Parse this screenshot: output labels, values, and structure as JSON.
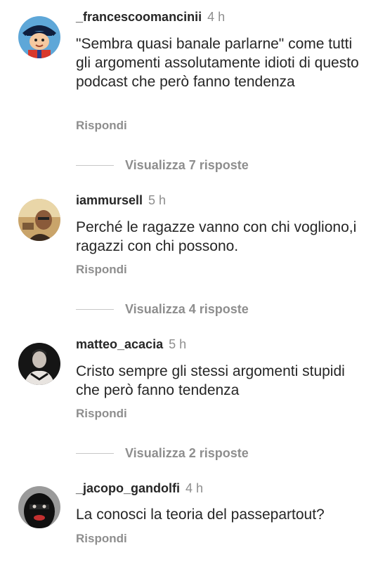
{
  "comments": [
    {
      "username": "_francescoomancinii",
      "time": "4 h",
      "text": "\"Sembra quasi banale parlarne\" come tutti gli argomenti assolutamente idioti di questo podcast che però fanno tendenza",
      "reply_label": "Rispondi",
      "view_replies": "Visualizza 7 risposte",
      "avatar_icon": "cartoon-character-avatar",
      "avatar_color": "#1d4f8c"
    },
    {
      "username": "iammursell",
      "time": "5 h",
      "text": "Perché le ragazze vanno con chi vogliono,i ragazzi con chi possono.",
      "reply_label": "Rispondi",
      "view_replies": "Visualizza 4 risposte",
      "avatar_icon": "photo-avatar",
      "avatar_color": "#6e4a2a"
    },
    {
      "username": "matteo_acacia",
      "time": "5 h",
      "text": "Cristo sempre gli stessi argomenti stupidi che però fanno tendenza",
      "reply_label": "Rispondi",
      "view_replies": "Visualizza 2 risposte",
      "avatar_icon": "photo-avatar",
      "avatar_color": "#1a1a1a"
    },
    {
      "username": "_jacopo_gandolfi",
      "time": "4 h",
      "text": "La conosci la teoria del passepartout?",
      "reply_label": "Rispondi",
      "avatar_icon": "masked-face-avatar",
      "avatar_color": "#111111"
    }
  ],
  "colors": {
    "text": "#262626",
    "secondary": "#8e8e8e",
    "divider": "#c7c7c7",
    "background": "#ffffff"
  }
}
